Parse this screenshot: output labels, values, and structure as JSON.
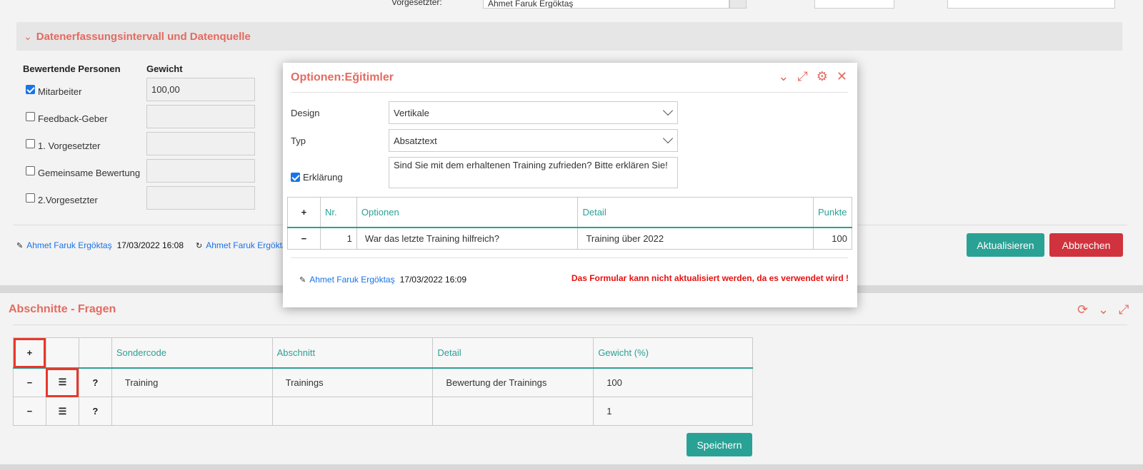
{
  "top_strip": {
    "supervisor_label": "Vorgesetzter:",
    "supervisor_value": "Ahmet Faruk Ergöktaş"
  },
  "data_section": {
    "title": "Datenerfassungsintervall und Datenquelle",
    "col_persons": "Bewertende Personen",
    "col_weight": "Gewicht",
    "rows": [
      {
        "label": "Mitarbeiter",
        "checked": true,
        "weight": "100,00"
      },
      {
        "label": "Feedback-Geber",
        "checked": false,
        "weight": ""
      },
      {
        "label": "1. Vorgesetzter",
        "checked": false,
        "weight": ""
      },
      {
        "label": "Gemeinsame Bewertung",
        "checked": false,
        "weight": ""
      },
      {
        "label": "2.Vorgesetzter",
        "checked": false,
        "weight": ""
      }
    ],
    "audit_creator": "Ahmet Faruk Ergöktaş",
    "audit_created": "17/03/2022 16:08",
    "audit_updater": "Ahmet Faruk Ergöktaş",
    "btn_update": "Aktualisieren",
    "btn_cancel": "Abbrechen"
  },
  "sections_panel": {
    "title": "Abschnitte - Fragen",
    "headers": [
      "Sondercode",
      "Abschnitt",
      "Detail",
      "Gewicht (%)"
    ],
    "rows": [
      {
        "code": "Training",
        "section": "Trainings",
        "detail": "Bewertung der Trainings",
        "weight": "100"
      },
      {
        "code": "",
        "section": "",
        "detail": "",
        "weight": "1"
      }
    ],
    "btn_save": "Speichern"
  },
  "modal": {
    "title": "Optionen:Eğitimler",
    "design_label": "Design",
    "design_value": "Vertikale",
    "type_label": "Typ",
    "type_value": "Absatztext",
    "explain_label": "Erklärung",
    "explain_checked": true,
    "explain_text": "Sind Sie mit dem erhaltenen Training zufrieden? Bitte erklären Sie!",
    "headers": {
      "nr": "Nr.",
      "options": "Optionen",
      "detail": "Detail",
      "points": "Punkte"
    },
    "rows": [
      {
        "nr": "1",
        "option": "War das letzte Training hilfreich?",
        "detail": "Training über 2022",
        "points": "100"
      }
    ],
    "audit_user": "Ahmet Faruk Ergöktaş",
    "audit_time": "17/03/2022 16:09",
    "warning": "Das Formular kann nicht aktualisiert werden, da es verwendet wird !"
  },
  "icons": {
    "expand": "✎",
    "colors": {
      "accent": "#e36b60",
      "teal": "#2aa195",
      "danger": "#d0333d",
      "link": "#1a73e8"
    }
  }
}
